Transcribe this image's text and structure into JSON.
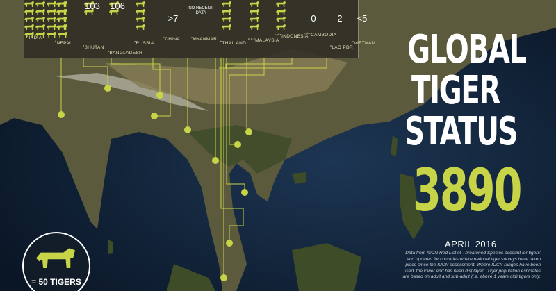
{
  "title": {
    "line1": "GLOBAL",
    "line2": "TIGER",
    "line3": "STATUS"
  },
  "total": "3890",
  "date": "APRIL 2016",
  "footnote": "Data from IUCN Red List of Threatened Species account for tigers' and updated for countries where national tiger surveys have taken place since the IUCN assessment. Where IUCN ranges have been used, the lower end has been displayed. Tiger population estimates are based on adult and sub-adult (i.e. above 1 years old) tigers only.",
  "legend": {
    "label": "= 50 TIGERS",
    "icon": "tiger-icon"
  },
  "countries": [
    {
      "name": "INDIA",
      "marker": "a",
      "count": "",
      "icons": 20
    },
    {
      "name": "NEPAL",
      "marker": "b",
      "count": "",
      "icons": 4
    },
    {
      "name": "BHUTAN",
      "marker": "b",
      "count": "103",
      "icons": 2
    },
    {
      "name": "BANGLADESH",
      "marker": "a",
      "count": "106",
      "icons": 2
    },
    {
      "name": "RUSSIA",
      "marker": "a",
      "count": "",
      "icons": 9
    },
    {
      "name": "CHINA",
      "marker": "c",
      "count": ">7",
      "icons": 0
    },
    {
      "name": "MYANMAR",
      "marker": "c",
      "count": "NO RECENT DATA",
      "icons": 0
    },
    {
      "name": "THAILAND",
      "marker": "b",
      "count": "",
      "icons": 4
    },
    {
      "name": "MALAYSIA",
      "marker": "c,d,e",
      "count": "",
      "icons": 5
    },
    {
      "name": "INDONESIA",
      "marker": "c,d,e",
      "count": "",
      "icons": 8
    },
    {
      "name": "CAMBODIA",
      "marker": "c,d,e",
      "count": "0",
      "icons": 0
    },
    {
      "name": "LAO PDR",
      "marker": "c",
      "count": "2",
      "icons": 0
    },
    {
      "name": "VIETNAM",
      "marker": "c",
      "count": "<5",
      "icons": 0
    }
  ]
}
